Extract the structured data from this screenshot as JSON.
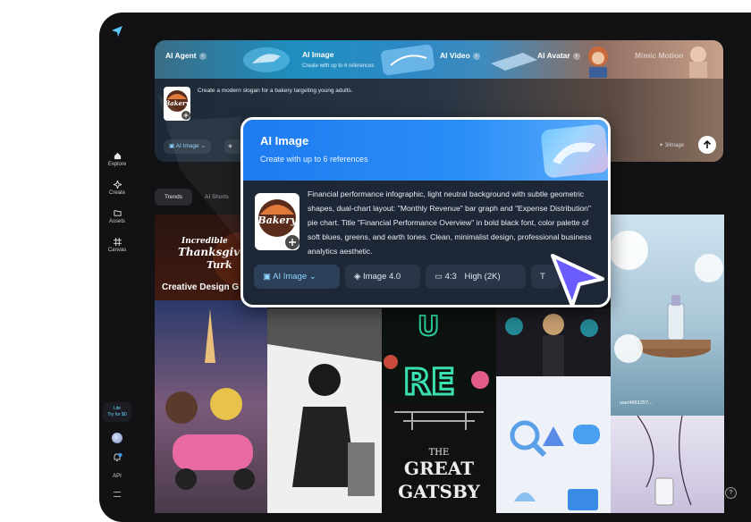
{
  "sidebar": {
    "items": [
      {
        "label": "Explore"
      },
      {
        "label": "Create"
      },
      {
        "label": "Assets"
      },
      {
        "label": "Canvas"
      }
    ],
    "lite_label": "Lite",
    "lite_sub": "Try for $0",
    "api_label": "API"
  },
  "hero": {
    "tabs": [
      {
        "label": "AI Agent"
      },
      {
        "label": "AI Image"
      },
      {
        "label": "AI Video"
      },
      {
        "label": "AI Avatar"
      },
      {
        "label": "Mimic Motion"
      }
    ],
    "active_sub": "Create with up to 6 references",
    "prompt": "Create a modern slogan for a bakery targeting young adults.",
    "mode_label": "AI Image",
    "credits": "3/image",
    "thumb_text": "Bakery"
  },
  "feed": {
    "tab_trends": "Trends",
    "tab_shorts": "AI Shorts",
    "creative_label": "Creative Design G",
    "thanksgiving_text": "Incredible Thanksgiving Turkey",
    "gatsby_text": "THE GREAT GATSBY",
    "neon_text": "URE",
    "product_user": "user4661257..."
  },
  "card": {
    "title": "AI Image",
    "subtitle": "Create with up to 6 references",
    "prompt": "Financial performance infographic, light neutral background with subtle geometric shapes, dual-chart layout: \"Monthly Revenue\" bar graph and \"Expense Distribution\" pie chart. Title \"Financial Performance Overview\" in bold black font, color palette of soft blues, greens, and earth tones. Clean, minimalist design, professional business analytics aesthetic.",
    "thumb_text": "Bakery",
    "pills": {
      "mode": "AI Image",
      "model": "Image 4.0",
      "ratio": "4:3",
      "quality": "High (2K)"
    }
  },
  "colors": {
    "accent": "#1e7bf0",
    "cursor": "#6b5cff",
    "background": "#121214"
  }
}
